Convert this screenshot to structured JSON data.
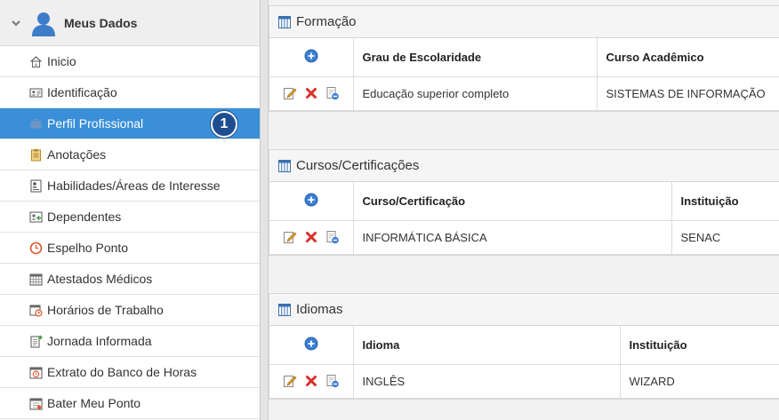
{
  "sidebar": {
    "header_title": "Meus Dados",
    "items": [
      {
        "label": "Inicio",
        "icon": "home-icon"
      },
      {
        "label": "Identificação",
        "icon": "id-card-icon"
      },
      {
        "label": "Perfil Profissional",
        "icon": "briefcase-icon",
        "active": true,
        "badge": "1"
      },
      {
        "label": "Anotações",
        "icon": "clipboard-icon"
      },
      {
        "label": "Habilidades/Áreas de Interesse",
        "icon": "profile-icon"
      },
      {
        "label": "Dependentes",
        "icon": "dependents-icon"
      },
      {
        "label": "Espelho Ponto",
        "icon": "clock-icon"
      },
      {
        "label": "Atestados Médicos",
        "icon": "calendar-grid-icon"
      },
      {
        "label": "Horários de Trabalho",
        "icon": "calendar-clock-icon"
      },
      {
        "label": "Jornada Informada",
        "icon": "document-add-icon"
      },
      {
        "label": "Extrato do Banco de Horas",
        "icon": "calendar-check-icon"
      },
      {
        "label": "Bater Meu Ponto",
        "icon": "calendar-punch-icon"
      }
    ]
  },
  "sections": {
    "formacao": {
      "title": "Formação",
      "columns": [
        "Grau de Escolaridade",
        "Curso Acadêmico"
      ],
      "rows": [
        [
          "Educação superior completo",
          "SISTEMAS DE INFORMAÇÃO"
        ]
      ]
    },
    "cursos": {
      "title": "Cursos/Certificações",
      "columns": [
        "Curso/Certificação",
        "Instituição"
      ],
      "rows": [
        [
          "INFORMÁTICA BÁSICA",
          "SENAC"
        ]
      ]
    },
    "idiomas": {
      "title": "Idiomas",
      "columns": [
        "Idioma",
        "Instituição"
      ],
      "rows": [
        [
          "INGLÊS",
          "WIZARD"
        ]
      ]
    }
  },
  "colors": {
    "active_bg": "#3a8fd8",
    "badge_bg": "#1f4e90",
    "add_icon": "#3b7fd4",
    "delete_icon": "#d9302a",
    "edit_icon": "#e0a526"
  }
}
